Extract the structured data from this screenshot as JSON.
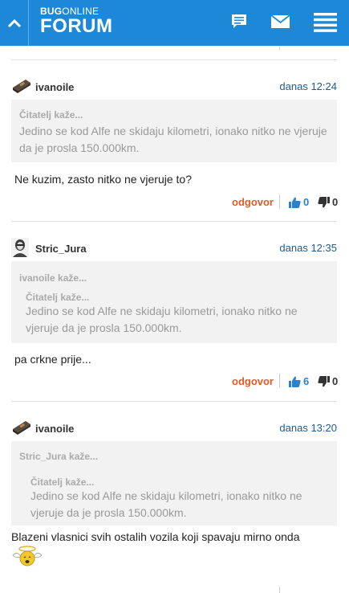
{
  "header": {
    "logo_top_bold": "BUG",
    "logo_top_light": "ONLINE",
    "logo_bottom": "FORUM",
    "icons": [
      "back-chevron-up-icon",
      "chat-icon",
      "mail-icon",
      "hamburger-menu-icon"
    ],
    "accent_color": "#1e88d8"
  },
  "posts": [
    {
      "username": "ivanoile",
      "time": "danas 12:24",
      "quote": {
        "author": "Čitatelj kaže...",
        "text": "Jedino se kod Alfe ne skidaju kilometri, ionako nitko ne vjeruje da je prosla 150.000km."
      },
      "body": "Ne kuzim, zasto nitko ne vjeruje to?",
      "reply_label": "odgovor",
      "likes": "0",
      "dislikes": "0"
    },
    {
      "username": "Stric_Jura",
      "time": "danas 12:35",
      "outer_quote_author": "ivanoile kaže...",
      "quote": {
        "author": "Čitatelj kaže...",
        "text": "Jedino se kod Alfe ne skidaju kilometri, ionako nitko ne vjeruje da je prosla 150.000km."
      },
      "body": "pa crkne prije...",
      "reply_label": "odgovor",
      "likes": "6",
      "dislikes": "0"
    },
    {
      "username": "ivanoile",
      "time": "danas 13:20",
      "outer_quote_author": "Stric_Jura kaže...",
      "quote": {
        "author": "Čitatelj kaže...",
        "text": "Jedino se kod Alfe ne skidaju kilometri, ionako nitko ne vjeruje da je prosla 150.000km."
      },
      "body": "Blazeni vlasnici svih ostalih vozila koji spavaju mirno onda",
      "emoticon": "angel-smiley-icon"
    }
  ],
  "colors": {
    "reply": "#e25a26",
    "like": "#2a82cc",
    "time": "#1c5a8e"
  }
}
